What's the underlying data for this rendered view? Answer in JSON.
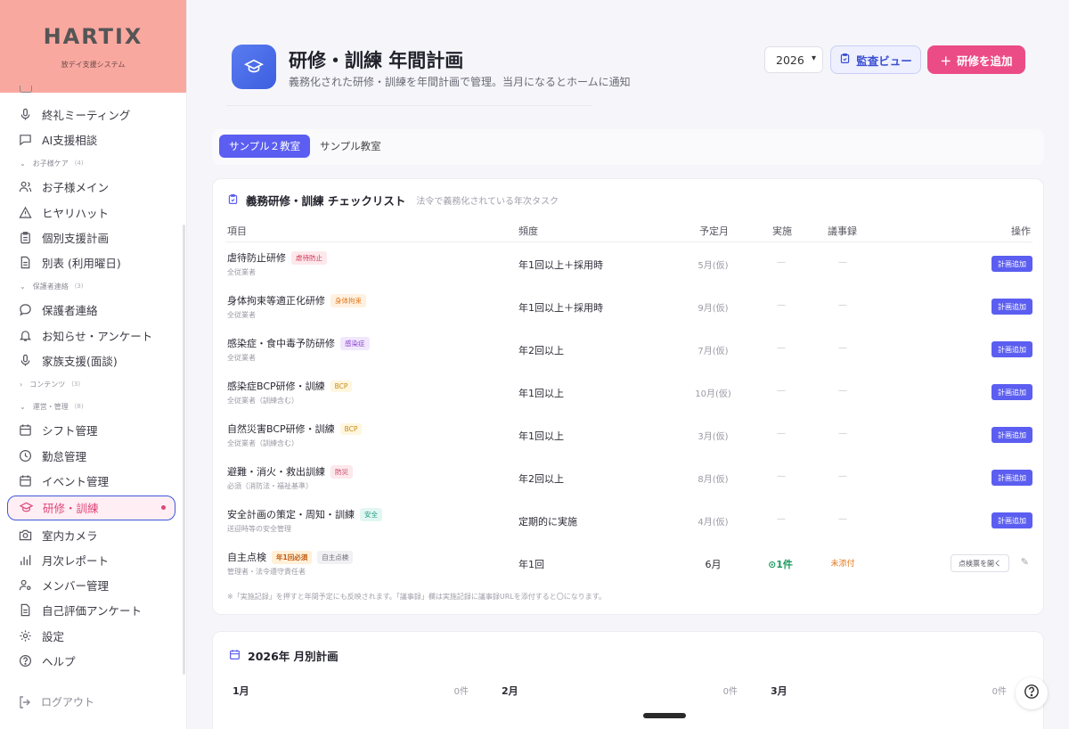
{
  "brand": {
    "name": "HARTIX",
    "subtitle": "放デイ支援システム"
  },
  "sidebar": {
    "items_top": [
      {
        "label": "終礼ミーティング",
        "icon": "mic-icon"
      },
      {
        "label": "AI支援相談",
        "icon": "chat-icon"
      }
    ],
    "sections": [
      {
        "label": "お子様ケア",
        "count": "(4)",
        "items": [
          {
            "label": "お子様メイン",
            "icon": "users-icon"
          },
          {
            "label": "ヒヤリハット",
            "icon": "warning-icon"
          },
          {
            "label": "個別支援計画",
            "icon": "clipboard-icon"
          },
          {
            "label": "別表 (利用曜日)",
            "icon": "document-icon"
          }
        ]
      },
      {
        "label": "保護者連絡",
        "count": "(3)",
        "items": [
          {
            "label": "保護者連絡",
            "icon": "chat-bubble-icon"
          },
          {
            "label": "お知らせ・アンケート",
            "icon": "bell-icon"
          },
          {
            "label": "家族支援(面談)",
            "icon": "mic-icon"
          }
        ]
      },
      {
        "label": "コンテンツ",
        "count": "(3)",
        "collapsed": true,
        "items": []
      },
      {
        "label": "運営・管理",
        "count": "(8)",
        "items": [
          {
            "label": "シフト管理",
            "icon": "calendar-icon"
          },
          {
            "label": "勤怠管理",
            "icon": "clock-icon"
          },
          {
            "label": "イベント管理",
            "icon": "calendar-icon"
          },
          {
            "label": "研修・訓練",
            "icon": "graduation-cap-icon",
            "active": true
          },
          {
            "label": "室内カメラ",
            "icon": "camera-icon"
          },
          {
            "label": "月次レポート",
            "icon": "bar-chart-icon"
          },
          {
            "label": "メンバー管理",
            "icon": "user-gear-icon"
          },
          {
            "label": "自己評価アンケート",
            "icon": "document-icon"
          },
          {
            "label": "設定",
            "icon": "gear-icon"
          },
          {
            "label": "ヘルプ",
            "icon": "help-icon"
          }
        ]
      }
    ],
    "logout": "ログアウト"
  },
  "header": {
    "title": "研修・訓練 年間計画",
    "subtitle": "義務化された研修・訓練を年間計画で管理。当月になるとホームに通知",
    "year": "2026",
    "audit_label": "監査ビュー",
    "add_label": "研修を追加"
  },
  "tabs": [
    "サンプル２教室",
    "サンプル教室"
  ],
  "checklist": {
    "title": "義務研修・訓練 チェックリスト",
    "subtitle": "法令で義務化されている年次タスク",
    "headers": {
      "item": "項目",
      "freq": "頻度",
      "month": "予定月",
      "impl": "実施",
      "minutes": "議事録",
      "op": "操作"
    },
    "rows": [
      {
        "name": "虐待防止研修",
        "tag": "虐待防止",
        "tag_color": "red",
        "desc": "全従業者",
        "freq": "年1回以上＋採用時",
        "month": "5月(仮)",
        "impl": "—",
        "minutes": "—",
        "op": "計画追加"
      },
      {
        "name": "身体拘束等適正化研修",
        "tag": "身体拘束",
        "tag_color": "orange",
        "desc": "全従業者",
        "freq": "年1回以上＋採用時",
        "month": "9月(仮)",
        "impl": "—",
        "minutes": "—",
        "op": "計画追加"
      },
      {
        "name": "感染症・食中毒予防研修",
        "tag": "感染症",
        "tag_color": "purple",
        "desc": "全従業者",
        "freq": "年2回以上",
        "month": "7月(仮)",
        "impl": "—",
        "minutes": "—",
        "op": "計画追加"
      },
      {
        "name": "感染症BCP研修・訓練",
        "tag": "BCP",
        "tag_color": "amber",
        "desc": "全従業者（訓練含む）",
        "freq": "年1回以上",
        "month": "10月(仮)",
        "impl": "—",
        "minutes": "—",
        "op": "計画追加"
      },
      {
        "name": "自然災害BCP研修・訓練",
        "tag": "BCP",
        "tag_color": "amber",
        "desc": "全従業者（訓練含む）",
        "freq": "年1回以上",
        "month": "3月(仮)",
        "impl": "—",
        "minutes": "—",
        "op": "計画追加"
      },
      {
        "name": "避難・消火・救出訓練",
        "tag": "防災",
        "tag_color": "pink",
        "desc": "必須（消防法・福祉基準）",
        "freq": "年2回以上",
        "month": "8月(仮)",
        "impl": "—",
        "minutes": "—",
        "op": "計画追加"
      },
      {
        "name": "安全計画の策定・周知・訓練",
        "tag": "安全",
        "tag_color": "teal",
        "desc": "送迎時等の安全管理",
        "freq": "定期的に実施",
        "month": "4月(仮)",
        "impl": "—",
        "minutes": "—",
        "op": "計画追加"
      }
    ],
    "last_row": {
      "name": "自主点検",
      "tag1": "年1回必須",
      "tag2": "自主点検",
      "desc": "管理者・法令遵守責任者",
      "freq": "年1回",
      "month": "6月",
      "impl": "1件",
      "minutes": "未添付",
      "op": "点検票を開く"
    },
    "note": "※「実施記録」を押すと年間予定にも反映されます。「議事録」欄は実施記録に議事録URLを添付すると〇になります。"
  },
  "monthly": {
    "title": "2026年 月別計画",
    "months": [
      {
        "label": "1月",
        "count": "0件"
      },
      {
        "label": "2月",
        "count": "0件"
      },
      {
        "label": "3月",
        "count": "0件"
      }
    ]
  },
  "colors": {
    "accent": "#5b5ef0",
    "pink": "#ec4c86",
    "logo_bg": "#f9a8a0"
  }
}
